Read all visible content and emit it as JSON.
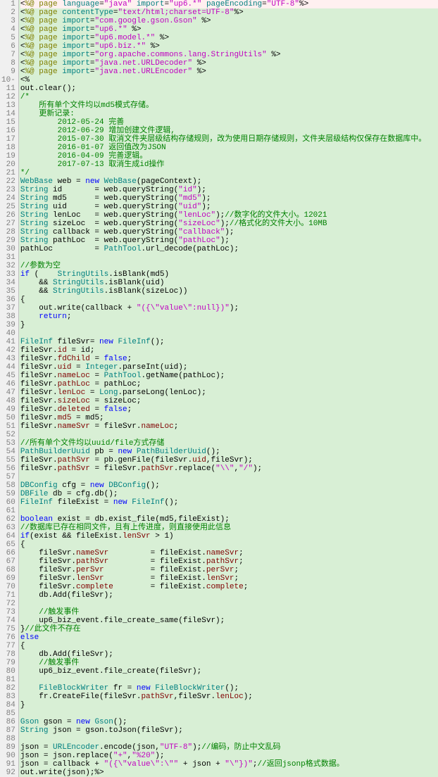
{
  "lines": [
    {
      "n": 1,
      "cls": "l1",
      "html": "<span class='tag'>&lt;</span><span class='dir'>%@ page</span> <span class='attr'>language</span>=<span class='str'>\"java\"</span> <span class='attr'>import</span>=<span class='str'>\"up6.*\"</span> <span class='attr'>pageEncoding</span>=<span class='str'>\"UTF-8\"</span><span class='tag'>%&gt;</span>"
    },
    {
      "n": 2,
      "html": "<span class='tag'>&lt;</span><span class='dir'>%@ page</span> <span class='attr'>contentType</span>=<span class='str'>\"text/html;charset=UTF-8\"</span><span class='tag'>%&gt;</span>"
    },
    {
      "n": 3,
      "html": "<span class='tag'>&lt;</span><span class='dir'>%@ page</span> <span class='attr'>import</span>=<span class='str'>\"com.google.gson.Gson\"</span> <span class='tag'>%&gt;</span>"
    },
    {
      "n": 4,
      "html": "<span class='tag'>&lt;</span><span class='dir'>%@ page</span> <span class='attr'>import</span>=<span class='str'>\"up6.*\"</span> <span class='tag'>%&gt;</span>"
    },
    {
      "n": 5,
      "html": "<span class='tag'>&lt;</span><span class='dir'>%@ page</span> <span class='attr'>import</span>=<span class='str'>\"up6.model.*\"</span> <span class='tag'>%&gt;</span>"
    },
    {
      "n": 6,
      "html": "<span class='tag'>&lt;</span><span class='dir'>%@ page</span> <span class='attr'>import</span>=<span class='str'>\"up6.biz.*\"</span> <span class='tag'>%&gt;</span>"
    },
    {
      "n": 7,
      "html": "<span class='tag'>&lt;</span><span class='dir'>%@ page</span> <span class='attr'>import</span>=<span class='str'>\"org.apache.commons.lang.StringUtils\"</span> <span class='tag'>%&gt;</span>"
    },
    {
      "n": 8,
      "html": "<span class='tag'>&lt;</span><span class='dir'>%@ page</span> <span class='attr'>import</span>=<span class='str'>\"java.net.URLDecoder\"</span> <span class='tag'>%&gt;</span>"
    },
    {
      "n": 9,
      "html": "<span class='tag'>&lt;</span><span class='dir'>%@ page</span> <span class='attr'>import</span>=<span class='str'>\"java.net.URLEncoder\"</span> <span class='tag'>%&gt;</span>"
    },
    {
      "n": 10,
      "gutter": "-",
      "html": "<span class='tag'>&lt;%</span>"
    },
    {
      "n": 11,
      "html": "out.clear();"
    },
    {
      "n": 12,
      "html": "<span class='cmt'>/*</span>"
    },
    {
      "n": 13,
      "html": "<span class='cmt'>    所有单个文件均以md5模式存储。</span>"
    },
    {
      "n": 14,
      "html": "<span class='cmt'>    更新记录:</span>"
    },
    {
      "n": 15,
      "html": "<span class='cmt'>        2012-05-24 完善</span>"
    },
    {
      "n": 16,
      "html": "<span class='cmt'>        2012-06-29 增加创建文件逻辑,</span>"
    },
    {
      "n": 17,
      "html": "<span class='cmt'>        2015-07-30 取消文件夹层级结构存储规则，改为使用日期存储规则，文件夹层级结构仅保存在数据库中。</span>"
    },
    {
      "n": 18,
      "html": "<span class='cmt'>        2016-01-07 返回值改为JSON</span>"
    },
    {
      "n": 19,
      "html": "<span class='cmt'>        2016-04-09 完善逻辑。</span>"
    },
    {
      "n": 20,
      "html": "<span class='cmt'>        2017-07-13 取消生成id操作</span>"
    },
    {
      "n": 21,
      "html": "<span class='cmt'>*/</span>"
    },
    {
      "n": 22,
      "html": "<span class='cls'>WebBase</span> web = <span class='kw'>new</span> <span class='cls'>WebBase</span>(pageContext);"
    },
    {
      "n": 23,
      "html": "<span class='cls'>String</span> id       = web.queryString(<span class='str'>\"id\"</span>);"
    },
    {
      "n": 24,
      "html": "<span class='cls'>String</span> md5      = web.queryString(<span class='str'>\"md5\"</span>);"
    },
    {
      "n": 25,
      "html": "<span class='cls'>String</span> uid      = web.queryString(<span class='str'>\"uid\"</span>);"
    },
    {
      "n": 26,
      "html": "<span class='cls'>String</span> lenLoc   = web.queryString(<span class='str'>\"lenLoc\"</span>);<span class='cmt'>//数字化的文件大小。12021</span>"
    },
    {
      "n": 27,
      "html": "<span class='cls'>String</span> sizeLoc  = web.queryString(<span class='str'>\"sizeLoc\"</span>);<span class='cmt'>//格式化的文件大小。10MB</span>"
    },
    {
      "n": 28,
      "html": "<span class='cls'>String</span> callback = web.queryString(<span class='str'>\"callback\"</span>);"
    },
    {
      "n": 29,
      "html": "<span class='cls'>String</span> pathLoc  = web.queryString(<span class='str'>\"pathLoc\"</span>);"
    },
    {
      "n": 30,
      "html": "pathLoc         = <span class='cls'>PathTool</span>.url_decode(pathLoc);"
    },
    {
      "n": 31,
      "html": ""
    },
    {
      "n": 32,
      "html": "<span class='cmt'>//参数为空</span>"
    },
    {
      "n": 33,
      "html": "<span class='kw'>if</span> (    <span class='cls'>StringUtils</span>.isBlank(md5)"
    },
    {
      "n": 34,
      "html": "    &amp;&amp; <span class='cls'>StringUtils</span>.isBlank(uid)"
    },
    {
      "n": 35,
      "html": "    &amp;&amp; <span class='cls'>StringUtils</span>.isBlank(sizeLoc))"
    },
    {
      "n": 36,
      "html": "{"
    },
    {
      "n": 37,
      "html": "    out.write(callback + <span class='str'>\"({\\\"value\\\":null})\"</span>);"
    },
    {
      "n": 38,
      "html": "    <span class='kw'>return</span>;"
    },
    {
      "n": 39,
      "html": "}"
    },
    {
      "n": 40,
      "html": ""
    },
    {
      "n": 41,
      "html": "<span class='cls'>FileInf</span> fileSvr= <span class='kw'>new</span> <span class='cls'>FileInf</span>();"
    },
    {
      "n": 42,
      "html": "fileSvr.<span class='fld'>id</span> = id;"
    },
    {
      "n": 43,
      "html": "fileSvr.<span class='fld'>fdChild</span> = <span class='kw'>false</span>;"
    },
    {
      "n": 44,
      "html": "fileSvr.<span class='fld'>uid</span> = <span class='cls'>Integer</span>.parseInt(uid);"
    },
    {
      "n": 45,
      "html": "fileSvr.<span class='fld'>nameLoc</span> = <span class='cls'>PathTool</span>.getName(pathLoc);"
    },
    {
      "n": 46,
      "html": "fileSvr.<span class='fld'>pathLoc</span> = pathLoc;"
    },
    {
      "n": 47,
      "html": "fileSvr.<span class='fld'>lenLoc</span> = <span class='cls'>Long</span>.parseLong(lenLoc);"
    },
    {
      "n": 48,
      "html": "fileSvr.<span class='fld'>sizeLoc</span> = sizeLoc;"
    },
    {
      "n": 49,
      "html": "fileSvr.<span class='fld'>deleted</span> = <span class='kw'>false</span>;"
    },
    {
      "n": 50,
      "html": "fileSvr.<span class='fld'>md5</span> = md5;"
    },
    {
      "n": 51,
      "html": "fileSvr.<span class='fld'>nameSvr</span> = fileSvr.<span class='fld'>nameLoc</span>;"
    },
    {
      "n": 52,
      "html": ""
    },
    {
      "n": 53,
      "html": "<span class='cmt'>//所有单个文件均以uuid/file方式存储</span>"
    },
    {
      "n": 54,
      "html": "<span class='cls'>PathBuilderUuid</span> pb = <span class='kw'>new</span> <span class='cls'>PathBuilderUuid</span>();"
    },
    {
      "n": 55,
      "html": "fileSvr.<span class='fld'>pathSvr</span> = pb.genFile(fileSvr.<span class='fld'>uid</span>,fileSvr);"
    },
    {
      "n": 56,
      "html": "fileSvr.<span class='fld'>pathSvr</span> = fileSvr.<span class='fld'>pathSvr</span>.replace(<span class='str'>\"\\\\\"</span>,<span class='str'>\"/\"</span>);"
    },
    {
      "n": 57,
      "html": ""
    },
    {
      "n": 58,
      "html": "<span class='cls'>DBConfig</span> cfg = <span class='kw'>new</span> <span class='cls'>DBConfig</span>();"
    },
    {
      "n": 59,
      "html": "<span class='cls'>DBFile</span> db = cfg.db();"
    },
    {
      "n": 60,
      "html": "<span class='cls'>FileInf</span> fileExist = <span class='kw'>new</span> <span class='cls'>FileInf</span>();"
    },
    {
      "n": 61,
      "html": ""
    },
    {
      "n": 62,
      "html": "<span class='kw'>boolean</span> exist = db.exist_file(md5,fileExist);"
    },
    {
      "n": 63,
      "html": "<span class='cmt'>//数据库已存在相同文件，且有上传进度，则直接使用此信息</span>"
    },
    {
      "n": 64,
      "html": "<span class='kw'>if</span>(exist &amp;&amp; fileExist.<span class='fld'>lenSvr</span> &gt; 1)"
    },
    {
      "n": 65,
      "html": "{"
    },
    {
      "n": 66,
      "html": "    fileSvr.<span class='fld'>nameSvr</span>         = fileExist.<span class='fld'>nameSvr</span>;"
    },
    {
      "n": 67,
      "html": "    fileSvr.<span class='fld'>pathSvr</span>         = fileExist.<span class='fld'>pathSvr</span>;"
    },
    {
      "n": 68,
      "html": "    fileSvr.<span class='fld'>perSvr</span>          = fileExist.<span class='fld'>perSvr</span>;"
    },
    {
      "n": 69,
      "html": "    fileSvr.<span class='fld'>lenSvr</span>          = fileExist.<span class='fld'>lenSvr</span>;"
    },
    {
      "n": 70,
      "html": "    fileSvr.<span class='fld'>complete</span>        = fileExist.<span class='fld'>complete</span>;"
    },
    {
      "n": 71,
      "html": "    db.Add(fileSvr);"
    },
    {
      "n": 72,
      "html": ""
    },
    {
      "n": 73,
      "html": "    <span class='cmt'>//触发事件</span>"
    },
    {
      "n": 74,
      "html": "    up6_biz_event.file_create_same(fileSvr);"
    },
    {
      "n": 75,
      "html": "}<span class='cmt'>//此文件不存在</span>"
    },
    {
      "n": 76,
      "html": "<span class='kw'>else</span>"
    },
    {
      "n": 77,
      "html": "{"
    },
    {
      "n": 78,
      "html": "    db.Add(fileSvr);"
    },
    {
      "n": 79,
      "html": "    <span class='cmt'>//触发事件</span>"
    },
    {
      "n": 80,
      "html": "    up6_biz_event.file_create(fileSvr);"
    },
    {
      "n": 81,
      "html": ""
    },
    {
      "n": 82,
      "html": "    <span class='cls'>FileBlockWriter</span> fr = <span class='kw'>new</span> <span class='cls'>FileBlockWriter</span>();"
    },
    {
      "n": 83,
      "html": "    fr.CreateFile(fileSvr.<span class='fld'>pathSvr</span>,fileSvr.<span class='fld'>lenLoc</span>);"
    },
    {
      "n": 84,
      "html": "}"
    },
    {
      "n": 85,
      "html": ""
    },
    {
      "n": 86,
      "html": "<span class='cls'>Gson</span> gson = <span class='kw'>new</span> <span class='cls'>Gson</span>();"
    },
    {
      "n": 87,
      "html": "<span class='cls'>String</span> json = gson.toJson(fileSvr);"
    },
    {
      "n": 88,
      "html": ""
    },
    {
      "n": 89,
      "html": "json = <span class='cls'>URLEncoder</span>.encode(json,<span class='str'>\"UTF-8\"</span>);<span class='cmt'>//编码，防止中文乱码</span>"
    },
    {
      "n": 90,
      "html": "json = json.replace(<span class='str'>\"+\"</span>,<span class='str'>\"%20\"</span>);"
    },
    {
      "n": 91,
      "html": "json = callback + <span class='str'>\"({\\\"value\\\":\\\"\"</span> + json + <span class='str'>\"\\\"})\"</span>;<span class='cmt'>//返回jsonp格式数据。</span>"
    },
    {
      "n": 92,
      "html": "out.write(json);<span class='tag'>%&gt;</span>"
    }
  ]
}
